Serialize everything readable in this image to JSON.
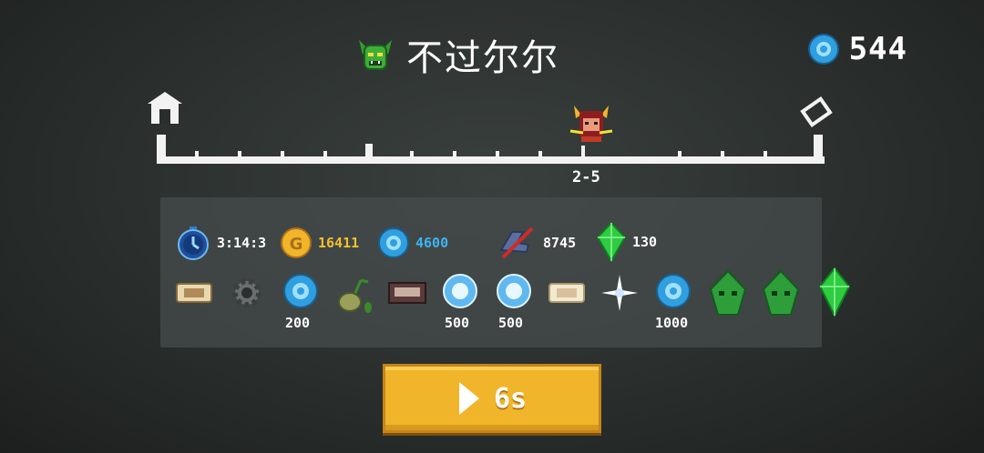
{
  "header": {
    "title": "不过尔尔",
    "currency_value": "544"
  },
  "progress": {
    "stage_label": "2-5",
    "fraction": 0.65
  },
  "stats": {
    "time": "3:14:3",
    "gold": "16411",
    "gems": "4600",
    "kills": "8745",
    "crystals": "130"
  },
  "items": {
    "gem_count_1": "200",
    "gem_count_2": "500",
    "gem_count_3": "500",
    "gem_count_4": "1000"
  },
  "play_button": {
    "label": "6s"
  },
  "colors": {
    "accent_gold": "#f0b52a",
    "gem_blue": "#2f9fe0",
    "crystal_green": "#2ecc40",
    "gold_text": "#f2c12e",
    "gem_text": "#3fb4f0"
  }
}
